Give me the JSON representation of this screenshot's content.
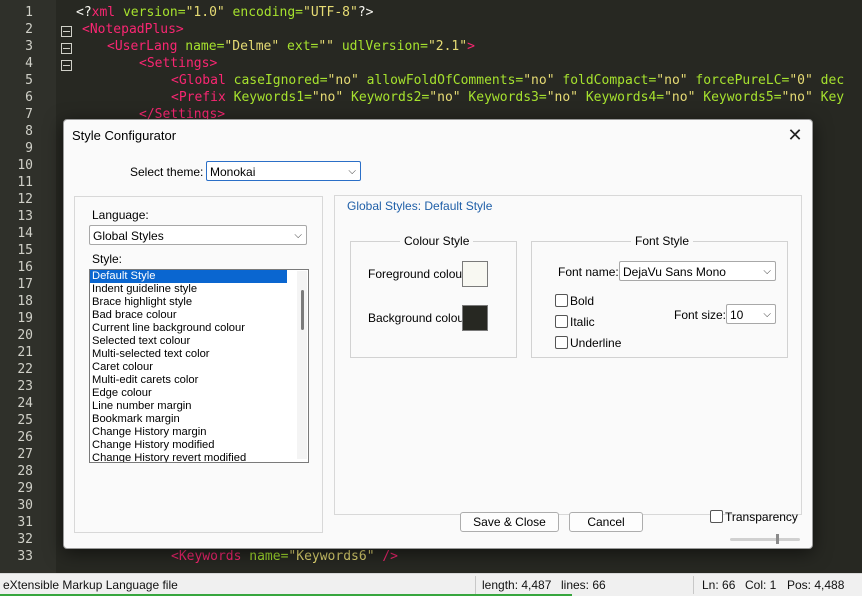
{
  "editor": {
    "line_numbers": [
      "1",
      "2",
      "3",
      "4",
      "5",
      "6",
      "7",
      "8",
      "9",
      "10",
      "11",
      "12",
      "13",
      "14",
      "15",
      "16",
      "17",
      "18",
      "19",
      "20",
      "21",
      "22",
      "23",
      "24",
      "25",
      "26",
      "27",
      "28",
      "29",
      "30",
      "31",
      "32",
      "33"
    ],
    "line1": {
      "p1": "<?",
      "p2": "xml",
      "p3": " version=",
      "p4": "\"1.0\"",
      "p5": " encoding=",
      "p6": "\"UTF-8\"",
      "p7": "?>"
    },
    "line2": {
      "tag": "<NotepadPlus>"
    },
    "line3": {
      "tag": "<UserLang",
      "a1": " name=",
      "v1": "\"Delme\"",
      "a2": " ext=",
      "v2": "\"\"",
      "a3": " udlVersion=",
      "v3": "\"2.1\"",
      "end": ">"
    },
    "line4": {
      "tag": "<Settings>"
    },
    "line5": {
      "tag": "<Global",
      "a1": " caseIgnored=",
      "v1": "\"no\"",
      "a2": " allowFoldOfComments=",
      "v2": "\"no\"",
      "a3": " foldCompact=",
      "v3": "\"no\"",
      "a4": " forcePureLC=",
      "v4": "\"0\"",
      "a5": " dec"
    },
    "line6": {
      "tag": "<Prefix",
      "a1": " Keywords1=",
      "v1": "\"no\"",
      "a2": " Keywords2=",
      "v2": "\"no\"",
      "a3": " Keywords3=",
      "v3": "\"no\"",
      "a4": " Keywords4=",
      "v4": "\"no\"",
      "a5": " Keywords5=",
      "v5": "\"no\"",
      "a6": " Key"
    },
    "line7": {
      "tag": "</Settings>"
    },
    "line33": {
      "tag": "<Keywords",
      "a1": " name=",
      "v1": "\"Keywords6\"",
      "end": " />"
    }
  },
  "dialog": {
    "title": "Style Configurator",
    "select_theme_label": "Select theme:",
    "theme_value": "Monokai",
    "language_label": "Language:",
    "language_value": "Global Styles",
    "style_label": "Style:",
    "styles": [
      "Default Style",
      "Indent guideline style",
      "Brace highlight style",
      "Bad brace colour",
      "Current line background colour",
      "Selected text colour",
      "Multi-selected text color",
      "Caret colour",
      "Multi-edit carets color",
      "Edge colour",
      "Line number margin",
      "Bookmark margin",
      "Change History margin",
      "Change History modified",
      "Change History revert modified"
    ],
    "section_title": "Global Styles: Default Style",
    "colour_style_title": "Colour Style",
    "foreground_label": "Foreground colour",
    "background_label": "Background colour",
    "foreground_color": "#f8f8f2",
    "background_color": "#272822",
    "font_style_title": "Font Style",
    "font_name_label": "Font name:",
    "font_name_value": "DejaVu Sans Mono",
    "bold_label": "Bold",
    "italic_label": "Italic",
    "underline_label": "Underline",
    "font_size_label": "Font size:",
    "font_size_value": "10",
    "save_close_label": "Save & Close",
    "cancel_label": "Cancel",
    "transparency_label": "Transparency",
    "close_glyph": "✕"
  },
  "statusbar": {
    "file_type": "eXtensible Markup Language file",
    "length": "length: 4,487",
    "lines": "lines: 66",
    "ln": "Ln: 66",
    "col": "Col: 1",
    "pos": "Pos: 4,488"
  },
  "colors": {
    "editor_bg": "#272822",
    "tag": "#f92672",
    "attr": "#a6e22e",
    "string": "#e6db74",
    "selection": "#0a66d0"
  }
}
